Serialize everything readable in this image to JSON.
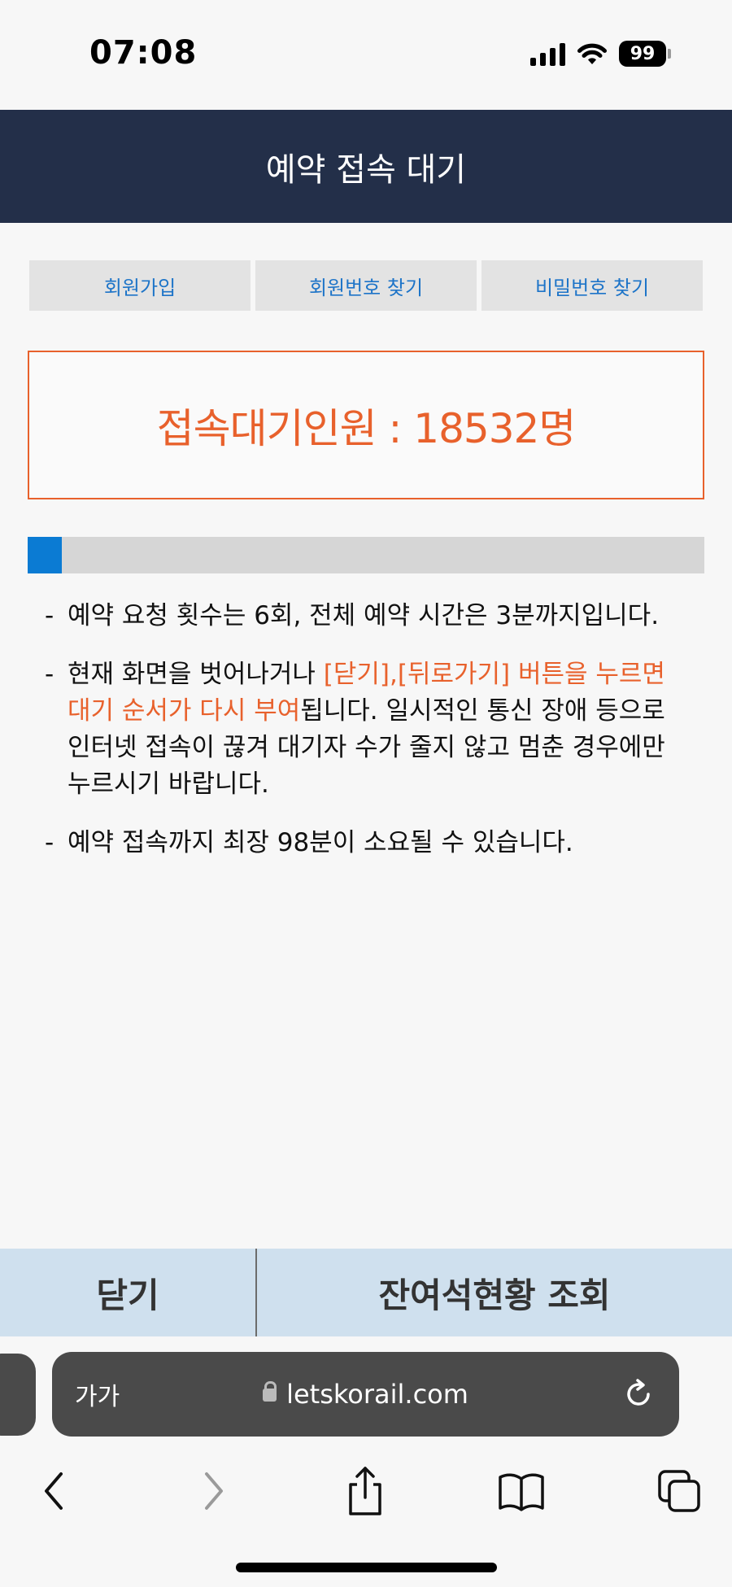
{
  "status_bar": {
    "time": "07:08",
    "battery": "99"
  },
  "header": {
    "title": "예약 접속 대기"
  },
  "top_buttons": [
    {
      "label": "회원가입"
    },
    {
      "label": "회원번호 찾기"
    },
    {
      "label": "비밀번호 찾기"
    }
  ],
  "queue": {
    "text": "접속대기인원 : 18532명",
    "progress": 0.05
  },
  "notices": {
    "n1": "예약 요청 횟수는 6회, 전체 예약 시간은 3분까지입니다.",
    "n2_plain_before": "현재 화면을 벗어나거나 ",
    "n2_highlight": "[닫기],[뒤로가기] 버튼을 누르면 대기 순서가 다시 부여",
    "n2_plain_after": "됩니다. 일시적인 통신 장애 등으로 인터넷 접속이 끊겨 대기자 수가 줄지 않고 멈춘 경우에만 누르시기 바랍니다.",
    "n3": "예약 접속까지 최장 98분이 소요될 수 있습니다.",
    "bullet": "-"
  },
  "actions": {
    "close": "닫기",
    "remaining_seats": "잔여석현황 조회"
  },
  "browser": {
    "text_size": "가가",
    "url": "letskorail.com"
  },
  "colors": {
    "header_bg": "#232f49",
    "accent_orange": "#e8612c",
    "link_blue": "#1d74c8",
    "progress_blue": "#0b7bd3",
    "action_bar_bg": "#cfe0ee"
  }
}
